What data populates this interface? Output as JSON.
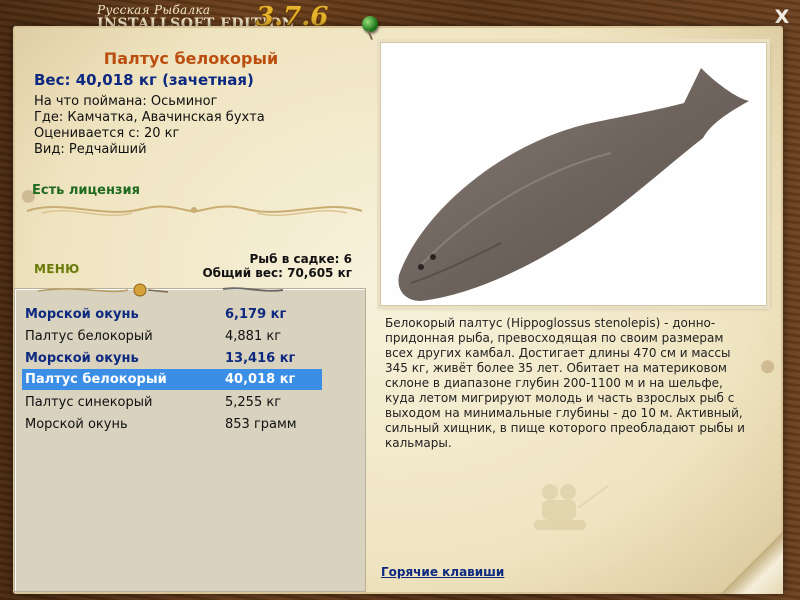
{
  "app": {
    "title_line1": "Русская Рыбалка",
    "title_line2": "INSTALLSOFT EDITION",
    "version": "3.7.6",
    "close_label": "X"
  },
  "fish": {
    "name": "Палтус белокорый",
    "weight_line": "Вес: 40,018 кг (зачетная)",
    "caught_on": "На что поймана: Осьминог",
    "location": "Где: Камчатка, Авачинская бухта",
    "valued_from": "Оценивается с: 20 кг",
    "kind": "Вид: Редчайший",
    "license": "Есть лицензия",
    "description": "Белокорый палтус (Hippoglossus stenolepis) - донно-придонная рыба, превосходящая по своим размерам всех других камбал. Достигает длины 470 см и массы 345 кг, живёт более 35 лет. Обитает на материковом склоне в диапазоне глубин 200-1100 м и на шельфе, куда летом мигрируют молодь и часть взрослых рыб с выходом на минимальные глубины - до 10 м. Активный, сильный хищник, в пище которого преобладают рыбы и кальмары."
  },
  "menu": {
    "label": "МЕНЮ"
  },
  "keep_net": {
    "count_line": "Рыб в садке: 6",
    "total_line": "Общий вес: 70,605 кг"
  },
  "catches": [
    {
      "name": "Морской окунь",
      "weight": "6,179 кг",
      "style": "bold"
    },
    {
      "name": "Палтус белокорый",
      "weight": "4,881 кг",
      "style": "normal"
    },
    {
      "name": "Морской окунь",
      "weight": "13,416 кг",
      "style": "bold"
    },
    {
      "name": "Палтус белокорый",
      "weight": "40,018 кг",
      "style": "selected"
    },
    {
      "name": "Палтус синекорый",
      "weight": "5,255 кг",
      "style": "normal"
    },
    {
      "name": "Морской окунь",
      "weight": "853 грамм",
      "style": "normal"
    }
  ],
  "footer": {
    "hotkeys": "Горячие клавиши"
  },
  "colors": {
    "fish_name": "#bb4d0e",
    "weight": "#0d2880",
    "license": "#1f6a1f",
    "selection": "#3b8ee6",
    "version": "#e6b52c"
  }
}
